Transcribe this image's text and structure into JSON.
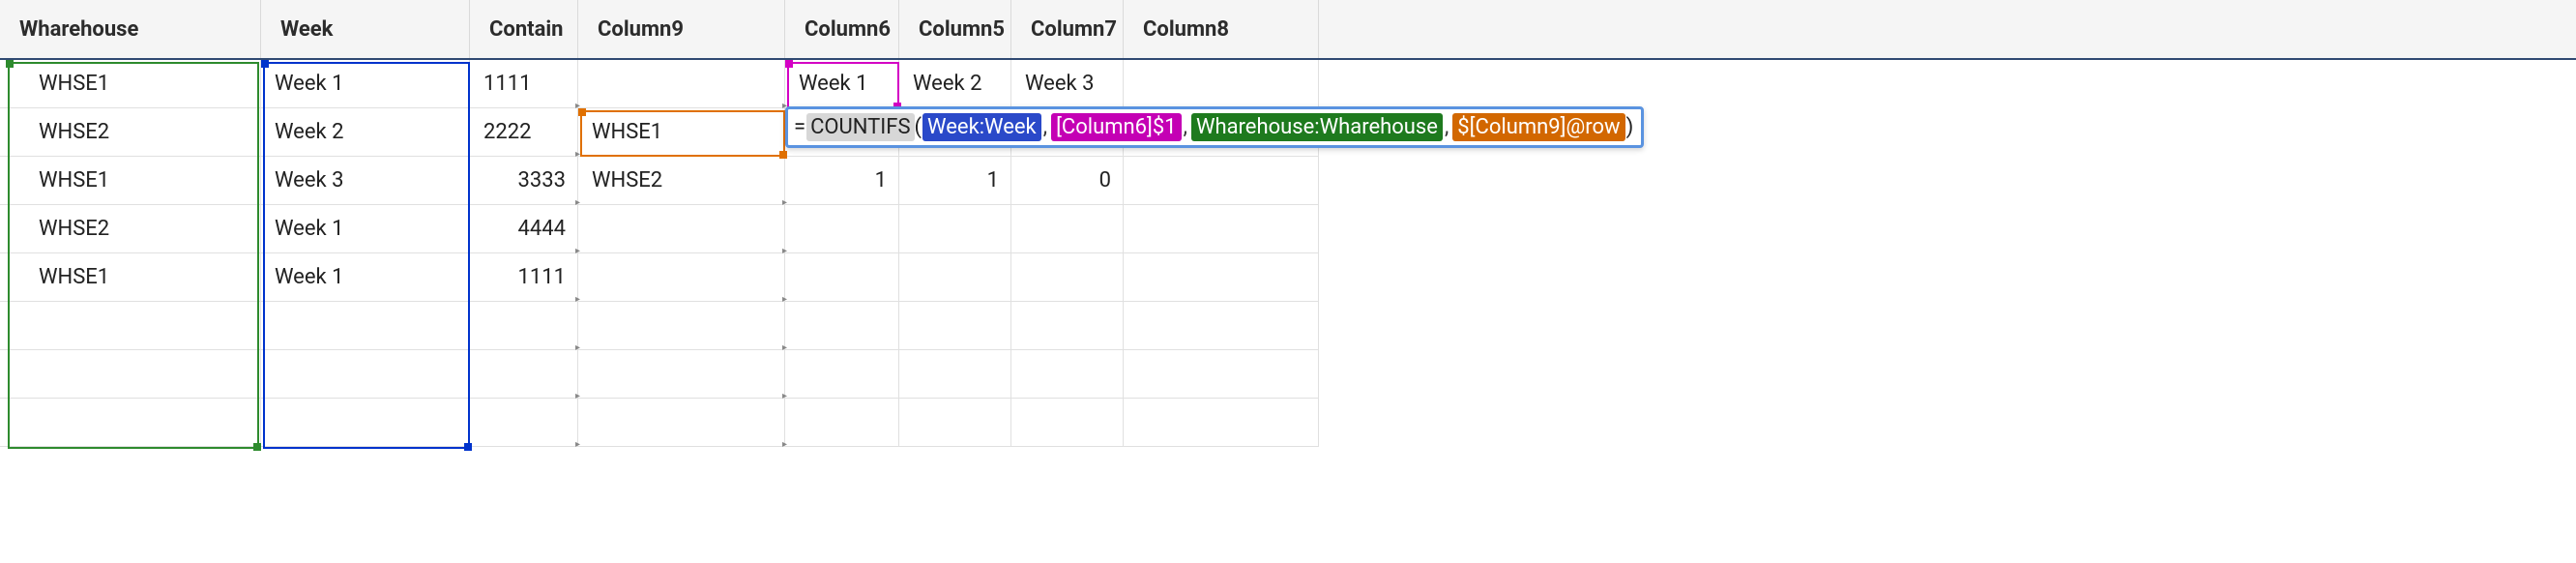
{
  "headers": {
    "wharehouse": "Wharehouse",
    "week": "Week",
    "contain": "Contain",
    "column9": "Column9",
    "column6": "Column6",
    "column5": "Column5",
    "column7": "Column7",
    "column8": "Column8"
  },
  "rows": [
    {
      "wh": "WHSE1",
      "wk": "Week 1",
      "ct": "1111",
      "c9": "",
      "c6": "Week 1",
      "c5": "Week 2",
      "c7": "Week 3",
      "c8": ""
    },
    {
      "wh": "WHSE2",
      "wk": "Week 2",
      "ct": "2222",
      "c9": "WHSE1",
      "c6": "",
      "c5": "",
      "c7": "",
      "c8": ""
    },
    {
      "wh": "WHSE1",
      "wk": "Week 3",
      "ct": "3333",
      "c9": "WHSE2",
      "c6": "1",
      "c5": "1",
      "c7": "0",
      "c8": ""
    },
    {
      "wh": "WHSE2",
      "wk": "Week 1",
      "ct": "4444",
      "c9": "",
      "c6": "",
      "c5": "",
      "c7": "",
      "c8": ""
    },
    {
      "wh": "WHSE1",
      "wk": "Week 1",
      "ct": "1111",
      "c9": "",
      "c6": "",
      "c5": "",
      "c7": "",
      "c8": ""
    },
    {
      "wh": "",
      "wk": "",
      "ct": "",
      "c9": "",
      "c6": "",
      "c5": "",
      "c7": "",
      "c8": ""
    },
    {
      "wh": "",
      "wk": "",
      "ct": "",
      "c9": "",
      "c6": "",
      "c5": "",
      "c7": "",
      "c8": ""
    },
    {
      "wh": "",
      "wk": "",
      "ct": "",
      "c9": "",
      "c6": "",
      "c5": "",
      "c7": "",
      "c8": ""
    }
  ],
  "formula": {
    "func": "COUNTIFS",
    "ref1": "Week:Week",
    "ref2": "[Column6]$1",
    "ref3": "Wharehouse:Wharehouse",
    "ref4": "$[Column9]@row"
  },
  "glyphs": {
    "expand": "▸"
  }
}
